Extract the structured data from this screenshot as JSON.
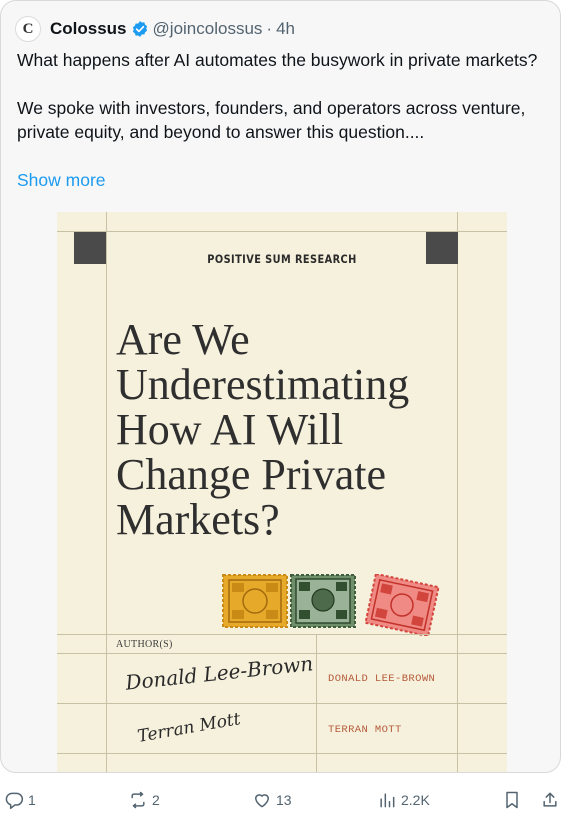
{
  "tweet": {
    "author_name": "Colossus",
    "avatar_letter": "C",
    "handle": "@joincolossus",
    "separator": "·",
    "time": "4h",
    "text_line1": "What happens after AI automates the busywork in private markets?",
    "text_line2": "We spoke with investors, founders, and operators across venture, private equity, and beyond to answer this question....",
    "show_more": "Show more"
  },
  "cover": {
    "brand": "POSITIVE SUM RESEARCH",
    "title_lines": [
      "Are We",
      "Underestimating",
      "How AI Will",
      "Change Private",
      "Markets?"
    ],
    "authors_label": "AUTHOR(S)",
    "authors": [
      {
        "signature": "Donald Lee-Brown",
        "name": "DONALD LEE-BROWN"
      },
      {
        "signature": "Terran Mott",
        "name": "TERRAN MOTT"
      }
    ]
  },
  "actions": {
    "reply_count": "1",
    "retweet_count": "2",
    "like_count": "13",
    "views_count": "2.2K"
  },
  "colors": {
    "link": "#1d9bf0",
    "muted": "#536471",
    "cover_bg": "#f6f1dc",
    "author_name": "#b55a3b"
  },
  "icons": [
    "verified-badge-icon",
    "reply-icon",
    "retweet-icon",
    "like-icon",
    "views-icon",
    "bookmark-icon",
    "share-icon"
  ]
}
